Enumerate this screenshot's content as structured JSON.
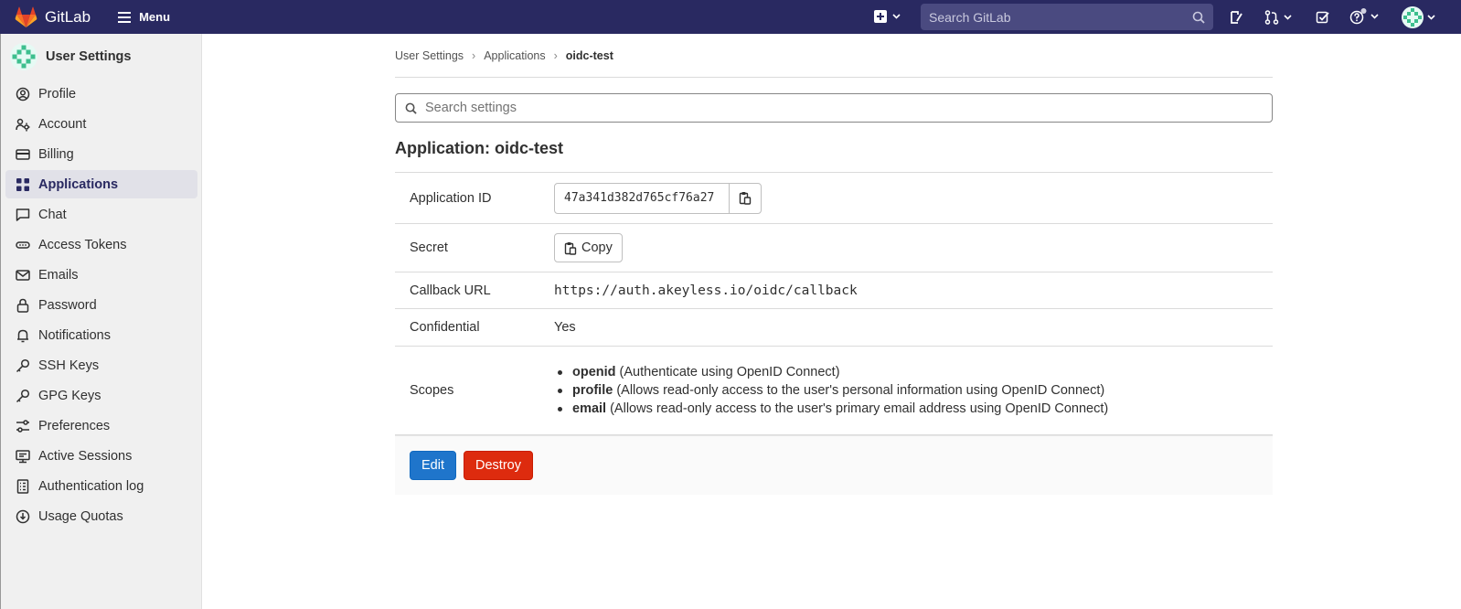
{
  "topbar": {
    "brand": "GitLab",
    "menu_label": "Menu",
    "search_placeholder": "Search GitLab",
    "icons": [
      "plus-square-icon",
      "chevron-down-icon",
      "search-icon",
      "issues-icon",
      "merge-request-icon",
      "todo-icon",
      "help-icon",
      "avatar"
    ]
  },
  "sidebar": {
    "title": "User Settings",
    "items": [
      {
        "label": "Profile",
        "icon": "profile-icon"
      },
      {
        "label": "Account",
        "icon": "account-icon"
      },
      {
        "label": "Billing",
        "icon": "billing-icon"
      },
      {
        "label": "Applications",
        "icon": "applications-icon",
        "active": true
      },
      {
        "label": "Chat",
        "icon": "chat-icon"
      },
      {
        "label": "Access Tokens",
        "icon": "token-icon"
      },
      {
        "label": "Emails",
        "icon": "mail-icon"
      },
      {
        "label": "Password",
        "icon": "lock-icon"
      },
      {
        "label": "Notifications",
        "icon": "bell-icon"
      },
      {
        "label": "SSH Keys",
        "icon": "key-icon"
      },
      {
        "label": "GPG Keys",
        "icon": "key-icon"
      },
      {
        "label": "Preferences",
        "icon": "preferences-icon"
      },
      {
        "label": "Active Sessions",
        "icon": "monitor-icon"
      },
      {
        "label": "Authentication log",
        "icon": "log-icon"
      },
      {
        "label": "Usage Quotas",
        "icon": "quota-icon"
      }
    ]
  },
  "breadcrumb": {
    "items": [
      "User Settings",
      "Applications",
      "oidc-test"
    ]
  },
  "search_settings": {
    "placeholder": "Search settings"
  },
  "page": {
    "title": "Application: oidc-test"
  },
  "application": {
    "id_label": "Application ID",
    "id_value": "47a341d382d765cf76a27",
    "secret_label": "Secret",
    "copy_label": "Copy",
    "callback_label": "Callback URL",
    "callback_value": "https://auth.akeyless.io/oidc/callback",
    "confidential_label": "Confidential",
    "confidential_value": "Yes",
    "scopes_label": "Scopes",
    "scopes": [
      {
        "name": "openid",
        "desc": "(Authenticate using OpenID Connect)"
      },
      {
        "name": "profile",
        "desc": "(Allows read-only access to the user's personal information using OpenID Connect)"
      },
      {
        "name": "email",
        "desc": "(Allows read-only access to the user's primary email address using OpenID Connect)"
      }
    ]
  },
  "actions": {
    "edit_label": "Edit",
    "destroy_label": "Destroy"
  },
  "colors": {
    "navbar": "#292961",
    "primary": "#1f75cb",
    "danger": "#dd2b0e",
    "sidebar": "#f0f0f0"
  }
}
